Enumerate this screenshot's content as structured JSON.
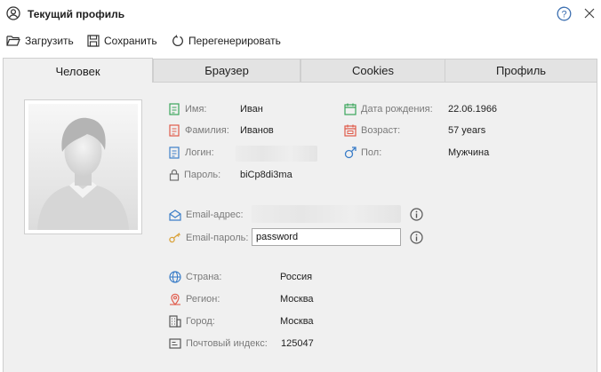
{
  "window": {
    "title": "Текущий профиль"
  },
  "toolbar": {
    "load": "Загрузить",
    "save": "Сохранить",
    "regenerate": "Перегенерировать"
  },
  "tabs": [
    {
      "label": "Человек",
      "active": true
    },
    {
      "label": "Браузер",
      "active": false
    },
    {
      "label": "Cookies",
      "active": false
    },
    {
      "label": "Профиль",
      "active": false
    }
  ],
  "person": {
    "first_name": {
      "label": "Имя:",
      "value": "Иван"
    },
    "last_name": {
      "label": "Фамилия:",
      "value": "Иванов"
    },
    "login": {
      "label": "Логин:",
      "value": ""
    },
    "password": {
      "label": "Пароль:",
      "value": "biCp8di3ma"
    },
    "birth_date": {
      "label": "Дата рождения:",
      "value": "22.06.1966"
    },
    "age": {
      "label": "Возраст:",
      "value": "57 years"
    },
    "gender": {
      "label": "Пол:",
      "value": "Мужчина"
    },
    "email": {
      "label": "Email-адрес:",
      "value": ""
    },
    "email_password": {
      "label": "Email-пароль:",
      "value": "password"
    },
    "country": {
      "label": "Страна:",
      "value": "Россия"
    },
    "region": {
      "label": "Регион:",
      "value": "Москва"
    },
    "city": {
      "label": "Город:",
      "value": "Москва"
    },
    "zip": {
      "label": "Почтовый индекс:",
      "value": "125047"
    }
  },
  "colors": {
    "green": "#3aa55a",
    "red": "#e05a4a",
    "blue": "#3c7ec8",
    "gray": "#6f6f6f",
    "orange": "#d9a23a"
  }
}
